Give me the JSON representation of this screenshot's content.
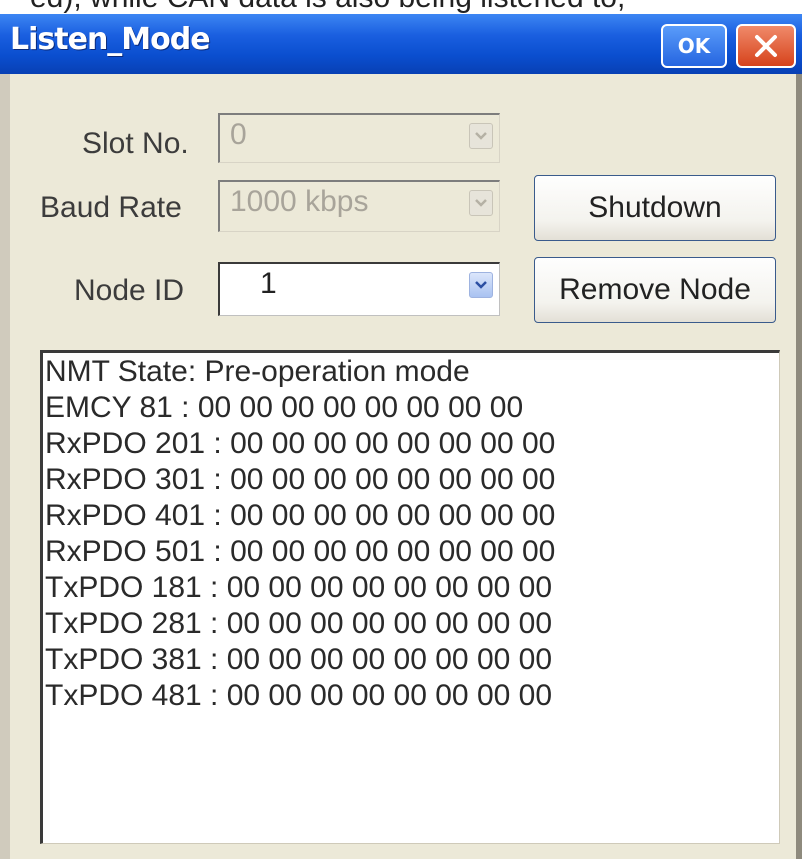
{
  "top_clipped_text": "ed), while CAN data is also being listened to,",
  "window": {
    "title": "Listen_Mode",
    "ok_label": "OK",
    "close_icon": "close-icon"
  },
  "form": {
    "slot_label": "Slot No.",
    "slot_value": "0",
    "baud_label": "Baud Rate",
    "baud_value": "1000 kbps",
    "node_label": "Node ID",
    "node_value": "1"
  },
  "buttons": {
    "shutdown": "Shutdown",
    "remove_node": "Remove Node"
  },
  "log": {
    "lines": [
      "NMT State: Pre-operation mode",
      "EMCY 81 : 00 00 00 00 00 00 00 00",
      "RxPDO 201 : 00 00 00 00 00 00 00 00",
      "RxPDO 301 : 00 00 00 00 00 00 00 00",
      "RxPDO 401 : 00 00 00 00 00 00 00 00",
      "RxPDO 501 : 00 00 00 00 00 00 00 00",
      "TxPDO 181 : 00 00 00 00 00 00 00 00",
      "TxPDO 281 : 00 00 00 00 00 00 00 00",
      "TxPDO 381 : 00 00 00 00 00 00 00 00",
      "TxPDO 481 : 00 00 00 00 00 00 00 00"
    ]
  },
  "colors": {
    "titlebar": "#0a4ecf",
    "dialog_bg": "#ece9d8",
    "close_red": "#d6431c"
  }
}
